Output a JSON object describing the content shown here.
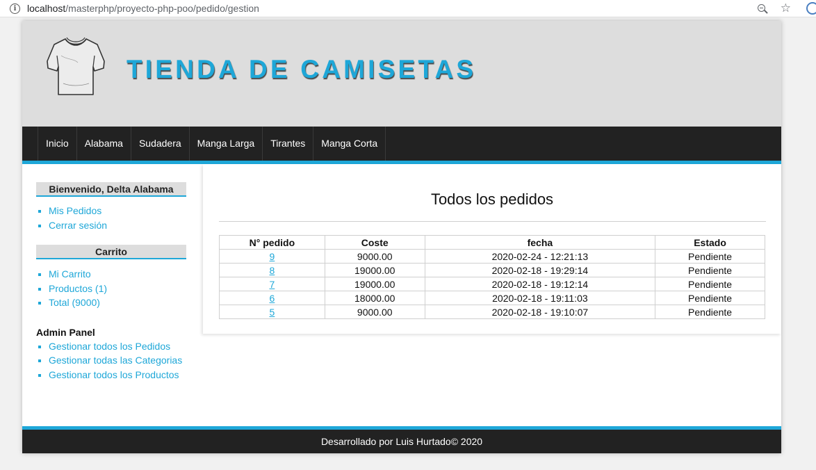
{
  "browser": {
    "url_host": "localhost",
    "url_path": "/masterphp/proyecto-php-poo/pedido/gestion"
  },
  "header": {
    "title": "TIENDA DE CAMISETAS",
    "logo_icon": "tshirt-icon"
  },
  "nav": {
    "items": [
      "Inicio",
      "Alabama",
      "Sudadera",
      "Manga Larga",
      "Tirantes",
      "Manga Corta"
    ]
  },
  "sidebar": {
    "user_title": "Bienvenido, Delta Alabama",
    "user_links": [
      "Mis Pedidos",
      "Cerrar sesión"
    ],
    "cart_title": "Carrito",
    "cart_links": [
      "Mi Carrito",
      "Productos (1)",
      "Total (9000)"
    ],
    "admin_title": "Admin Panel",
    "admin_links": [
      "Gestionar todos los Pedidos",
      "Gestionar todas las Categorias",
      "Gestionar todos los Productos"
    ]
  },
  "main": {
    "title": "Todos los pedidos",
    "columns": [
      "N° pedido",
      "Coste",
      "fecha",
      "Estado"
    ],
    "rows": [
      {
        "id": "9",
        "coste": "9000.00",
        "fecha": "2020-02-24 - 12:21:13",
        "estado": "Pendiente"
      },
      {
        "id": "8",
        "coste": "19000.00",
        "fecha": "2020-02-18 - 19:29:14",
        "estado": "Pendiente"
      },
      {
        "id": "7",
        "coste": "19000.00",
        "fecha": "2020-02-18 - 19:12:14",
        "estado": "Pendiente"
      },
      {
        "id": "6",
        "coste": "18000.00",
        "fecha": "2020-02-18 - 19:11:03",
        "estado": "Pendiente"
      },
      {
        "id": "5",
        "coste": "9000.00",
        "fecha": "2020-02-18 - 19:10:07",
        "estado": "Pendiente"
      }
    ]
  },
  "footer": {
    "text": "Desarrollado por Luis Hurtado© 2020"
  },
  "colors": {
    "accent": "#1ea7d8",
    "dark": "#222222",
    "header_bg": "#dddddd"
  }
}
